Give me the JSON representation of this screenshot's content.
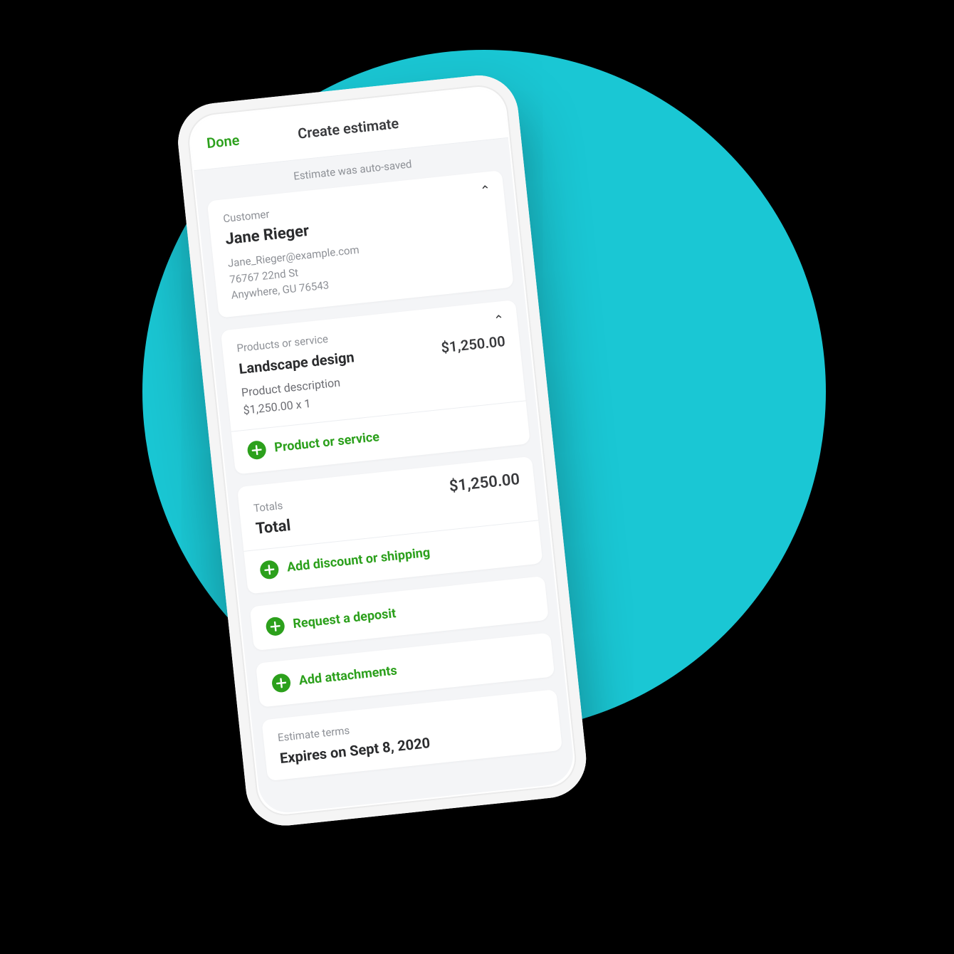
{
  "colors": {
    "accent_green": "#2ca01c",
    "circle_bg": "#1ac7d4"
  },
  "header": {
    "done": "Done",
    "title": "Create estimate"
  },
  "autosave": "Estimate was auto-saved",
  "customer": {
    "section_label": "Customer",
    "name": "Jane Rieger",
    "email": "Jane_Rieger@example.com",
    "address_line1": "76767 22nd St",
    "address_line2": "Anywhere, GU 76543"
  },
  "products": {
    "section_label": "Products or service",
    "items": [
      {
        "name": "Landscape design",
        "price": "$1,250.00",
        "description": "Product description",
        "rate_qty": "$1,250.00 x 1"
      }
    ],
    "add_action": "Product or service"
  },
  "totals": {
    "section_label": "Totals",
    "label": "Total",
    "amount": "$1,250.00",
    "add_discount_shipping": "Add discount or shipping"
  },
  "deposit": {
    "action": "Request a deposit"
  },
  "attachments": {
    "action": "Add attachments"
  },
  "terms": {
    "section_label": "Estimate terms",
    "value": "Expires on Sept 8, 2020"
  }
}
